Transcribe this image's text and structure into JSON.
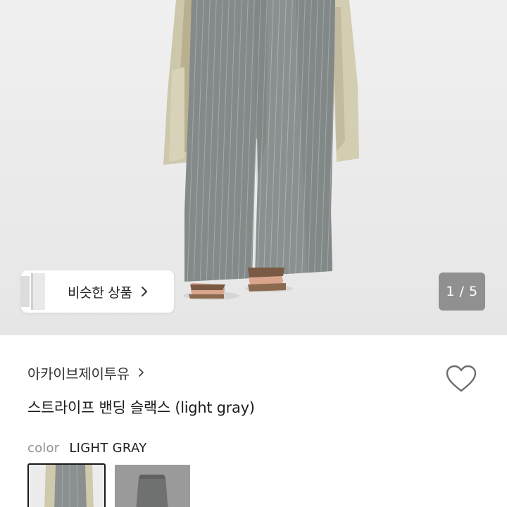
{
  "hero": {
    "image_alt": "grey pinstripe wide slacks worn with beige trench coat",
    "similar_button": {
      "label": "비슷한 상품"
    },
    "pager": {
      "text": "1 / 5"
    }
  },
  "product": {
    "shop_name": "아카이브제이투유",
    "title": "스트라이프 밴딩 슬랙스 (light gray)",
    "wishlist_icon": "heart-outline-icon"
  },
  "options": {
    "color_key": "color",
    "color_value": "LIGHT GRAY",
    "swatches": [
      {
        "name": "light-gray-worn",
        "selected": true
      },
      {
        "name": "light-gray-flat",
        "selected": false
      }
    ]
  },
  "colors": {
    "photo_bg": "#ededed",
    "trouser": "#8b9190",
    "coat": "#cfc9ad",
    "pager_bg": "#808080"
  }
}
